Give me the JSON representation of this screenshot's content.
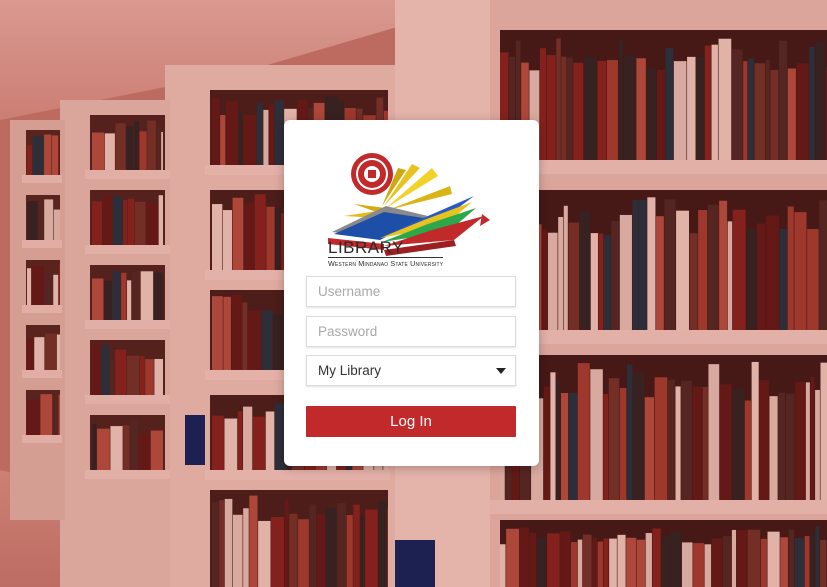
{
  "background": {
    "description_icon": "library-bookshelves-icon",
    "tint_color": "#c0392b"
  },
  "login_card": {
    "logo": {
      "seal_icon": "university-seal-icon",
      "title": "LIBRARY",
      "subtitle": "Western Mindanao State University"
    },
    "username_placeholder": "Username",
    "password_placeholder": "Password",
    "library_select": {
      "selected": "My Library"
    },
    "login_button_label": "Log In",
    "colors": {
      "button": "#c1292b",
      "card": "#ffffff"
    }
  }
}
